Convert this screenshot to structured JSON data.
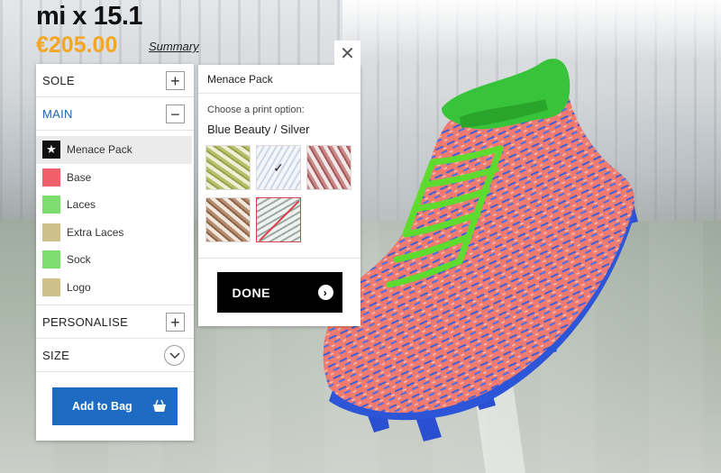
{
  "product": {
    "name": "mi x 15.1",
    "price": "€205.00",
    "summary_link": "Summary"
  },
  "panel": {
    "sections": {
      "sole": "SOLE",
      "main": "MAIN",
      "personalise": "PERSONALISE",
      "size": "SIZE"
    },
    "parts": [
      {
        "label": "Menace Pack",
        "color": "#111111",
        "icon": "star-icon",
        "selected": true
      },
      {
        "label": "Base",
        "color": "#f0606b",
        "icon": "",
        "selected": false
      },
      {
        "label": "Laces",
        "color": "#7dde6f",
        "icon": "",
        "selected": false
      },
      {
        "label": "Extra Laces",
        "color": "#cfc08a",
        "icon": "",
        "selected": false
      },
      {
        "label": "Sock",
        "color": "#7dde6f",
        "icon": "",
        "selected": false
      },
      {
        "label": "Logo",
        "color": "#cfc08a",
        "icon": "",
        "selected": false
      }
    ],
    "add_to_bag": "Add to Bag",
    "accent": "#1e6bc4"
  },
  "popup": {
    "title": "Menace Pack",
    "choose_label": "Choose a print option:",
    "selected_print": "Blue Beauty / Silver",
    "done_label": "DONE"
  }
}
